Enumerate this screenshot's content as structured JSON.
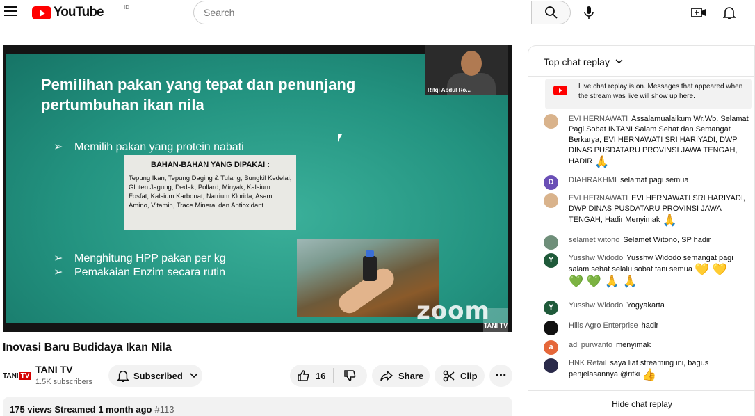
{
  "header": {
    "logo_text": "YouTube",
    "country_code": "ID",
    "search_placeholder": "Search",
    "icons": [
      "menu-icon",
      "search-icon",
      "mic-icon",
      "create-video-icon",
      "bell-icon"
    ]
  },
  "video": {
    "slide_title": "Pemilihan pakan yang tepat dan penunjang pertumbuhan ikan nila",
    "bullets": [
      "Memilih pakan yang protein nabati",
      "Menghitung HPP pakan per kg",
      "Pemakaian Enzim secara rutin"
    ],
    "bahan_title": "BAHAN-BAHAN YANG DIPAKAI :",
    "bahan_body": "Tepung Ikan, Tepung Daging & Tulang, Bungkil Kedelai, Gluten Jagung, Dedak, Pollard, Minyak, Kalsium Fosfat, Kalsium Karbonat, Natrium Klorida, Asam Amino, Vitamin, Trace Mineral dan Antioxidant.",
    "webcam_name": "Rifqi Abdul Ro...",
    "zoom_watermark": "zoom",
    "channel_watermark": "TANI TV",
    "title": "Inovasi Baru Budidaya Ikan Nila"
  },
  "channel": {
    "logo_text": "TANI",
    "logo_tv": "TV",
    "name": "TANI TV",
    "subscribers": "1.5K subscribers",
    "subscribed_label": "Subscribed"
  },
  "actions": {
    "like_count": "16",
    "share_label": "Share",
    "clip_label": "Clip",
    "more_label": "⋯"
  },
  "description": {
    "stats": "175 views  Streamed 1 month ago",
    "tag": "#113"
  },
  "chat": {
    "header": "Top chat replay",
    "notice": "Live chat replay is on. Messages that appeared when the stream was live will show up here.",
    "footer": "Hide chat replay",
    "messages": [
      {
        "author": "EVI HERNAWATI",
        "text": "Assalamualaikum Wr.Wb. Selamat Pagi Sobat INTANI Salam Sehat dan Semangat Berkarya, EVI HERNAWATI SRI HARIYADI, DWP DINAS PUSDATARU PROVINSI JAWA TENGAH, HADIR",
        "emoji": "🙏",
        "avatar_letter": "",
        "avatar_color": "#d9b38c"
      },
      {
        "author": "DIAHRAKHMI",
        "text": "selamat pagi semua",
        "emoji": "",
        "avatar_letter": "D",
        "avatar_color": "#6a4fb6"
      },
      {
        "author": "EVI HERNAWATI",
        "text": "EVI HERNAWATI SRI HARIYADI, DWP DINAS PUSDATARU PROVINSI JAWA TENGAH, Hadir Menyimak",
        "emoji": "🙏",
        "avatar_letter": "",
        "avatar_color": "#d9b38c"
      },
      {
        "author": "selamet witono",
        "text": "Selamet Witono, SP hadir",
        "emoji": "",
        "avatar_letter": "",
        "avatar_color": "#6f8f7a"
      },
      {
        "author": "Yusshw Widodo",
        "text": "Yusshw Widodo semangat pagi salam sehat selalu sobat tani semua",
        "emoji": "💛 💛",
        "emoji2": "💚 💚 🙏 🙏",
        "avatar_letter": "Y",
        "avatar_color": "#1f5a3a"
      },
      {
        "author": "Yusshw Widodo",
        "text": "Yogyakarta",
        "emoji": "",
        "avatar_letter": "Y",
        "avatar_color": "#1f5a3a"
      },
      {
        "author": "Hills Agro Enterprise",
        "text": "hadir",
        "emoji": "",
        "avatar_letter": "",
        "avatar_color": "#111111"
      },
      {
        "author": "adi purwanto",
        "text": "menyimak",
        "emoji": "",
        "avatar_letter": "a",
        "avatar_color": "#e5673a"
      },
      {
        "author": "HNK Retail",
        "text": "saya liat streaming ini, bagus penjelasannya @rifki",
        "emoji": "👍",
        "avatar_letter": "",
        "avatar_color": "#2a2a4a"
      }
    ]
  },
  "colors": {
    "brand_red": "#ff0000",
    "slide_green": "#239380"
  }
}
